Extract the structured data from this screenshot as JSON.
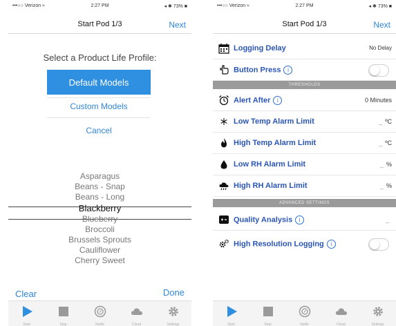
{
  "status": {
    "carrier": "•••○○ Verizon ≈",
    "time": "2:27 PM",
    "battery": "◂ ✱ 73% ■"
  },
  "left": {
    "nav_title": "Start Pod 1/3",
    "next": "Next",
    "prompt": "Select a Product Life Profile:",
    "default_models": "Default Models",
    "custom_models": "Custom Models",
    "cancel": "Cancel",
    "picker_items": [
      "Asparagus",
      "Beans - Snap",
      "Beans - Long",
      "Blackberry",
      "Blueberry",
      "Broccoli",
      "Brussels Sprouts",
      "Cauliflower",
      "Cherry Sweet"
    ],
    "selected_item": "Blackberry",
    "clear": "Clear",
    "done": "Done"
  },
  "tabs": [
    {
      "label": "Start",
      "icon": "play-icon",
      "color": "#2f8fe0"
    },
    {
      "label": "Stop",
      "icon": "stop-icon",
      "color": "#9a9a9a"
    },
    {
      "label": "Notifs",
      "icon": "compass-icon",
      "color": "#9a9a9a"
    },
    {
      "label": "Cloud",
      "icon": "cloud-icon",
      "color": "#9a9a9a"
    },
    {
      "label": "Settings",
      "icon": "gear-icon",
      "color": "#9a9a9a"
    }
  ],
  "right": {
    "nav_title": "Start Pod 1/3",
    "next": "Next",
    "logging_delay": {
      "label": "Logging Delay",
      "value": "No Delay"
    },
    "button_press": {
      "label": "Button Press",
      "info": "i"
    },
    "thresholds_header": "THRESHOLDS",
    "alert_after": {
      "label": "Alert After",
      "info": "i",
      "value": "0 Minutes"
    },
    "low_temp": {
      "label": "Low Temp Alarm Limit",
      "value": "ºC"
    },
    "high_temp": {
      "label": "High Temp Alarm Limit",
      "value": "ºC"
    },
    "low_rh": {
      "label": "Low RH Alarm Limit",
      "value": "%"
    },
    "high_rh": {
      "label": "High RH Alarm Limit",
      "value": "%"
    },
    "advanced_header": "ADVANCED SETTINGS",
    "quality_analysis": {
      "label": "Quality Analysis",
      "info": "i"
    },
    "high_res": {
      "label": "High Resolution Logging",
      "info": "i"
    }
  },
  "colors": {
    "accent": "#2f8fe0",
    "label_blue": "#2a55b5",
    "section_gray": "#9a9a9a"
  }
}
